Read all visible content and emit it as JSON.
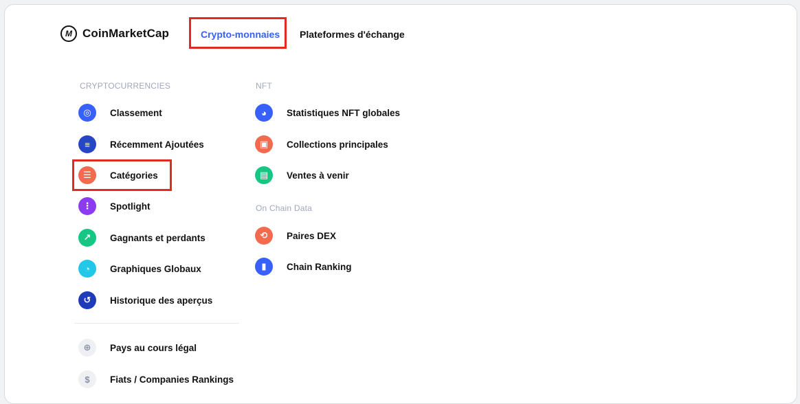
{
  "brand": {
    "name": "CoinMarketCap"
  },
  "nav": {
    "tabs": [
      {
        "label": "Crypto-monnaies",
        "active": true
      },
      {
        "label": "Plateformes d'échange",
        "active": false
      }
    ]
  },
  "menu": {
    "crypto": {
      "heading": "CRYPTOCURRENCIES",
      "items": [
        {
          "label": "Classement",
          "icon": "coinmarketcap-icon",
          "color": "#3861fb"
        },
        {
          "label": "Récemment Ajoutées",
          "icon": "list-add-icon",
          "color": "#2746c6"
        },
        {
          "label": "Catégories",
          "icon": "list-icon",
          "color": "#f26b4f"
        },
        {
          "label": "Spotlight",
          "icon": "grid-icon",
          "color": "#8b3cf0"
        },
        {
          "label": "Gagnants et perdants",
          "icon": "trend-up-icon",
          "color": "#16c784"
        },
        {
          "label": "Graphiques Globaux",
          "icon": "pie-chart-icon",
          "color": "#23c8e8"
        },
        {
          "label": "Historique des aperçus",
          "icon": "history-icon",
          "color": "#1f3bb8"
        }
      ],
      "footer_items": [
        {
          "label": "Pays au cours légal",
          "icon": "globe-icon"
        },
        {
          "label": "Fiats / Companies Rankings",
          "icon": "dollar-icon"
        }
      ]
    },
    "nft": {
      "heading": "NFT",
      "items": [
        {
          "label": "Statistiques NFT globales",
          "icon": "pie-chart-icon",
          "color": "#3861fb"
        },
        {
          "label": "Collections principales",
          "icon": "image-icon",
          "color": "#f26b4f"
        },
        {
          "label": "Ventes à venir",
          "icon": "calendar-icon",
          "color": "#16c784"
        }
      ]
    },
    "onchain": {
      "heading": "On Chain Data",
      "items": [
        {
          "label": "Paires DEX",
          "icon": "swap-icon",
          "color": "#f26b4f"
        },
        {
          "label": "Chain Ranking",
          "icon": "bar-chart-icon",
          "color": "#3861fb"
        }
      ]
    }
  },
  "highlight_color": "#e02b20"
}
